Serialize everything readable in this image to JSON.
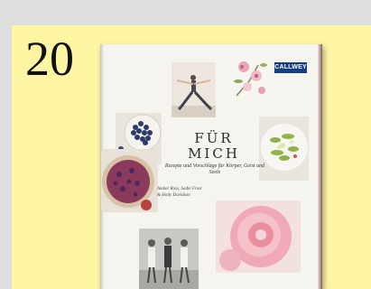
{
  "rank": "20",
  "book": {
    "publisher_logo": "CALLWEY",
    "title_line1": "FÜR",
    "title_line2": "MICH",
    "subtitle": "Rezepte und Vorschläge für Körper, Geist und Seele",
    "authors_line1": "Amber Ross, Sadie Frost",
    "authors_line2": "& Holly Davidson"
  },
  "colors": {
    "panel": "#fff6a4",
    "background": "#dedede",
    "logo": "#123d82"
  }
}
